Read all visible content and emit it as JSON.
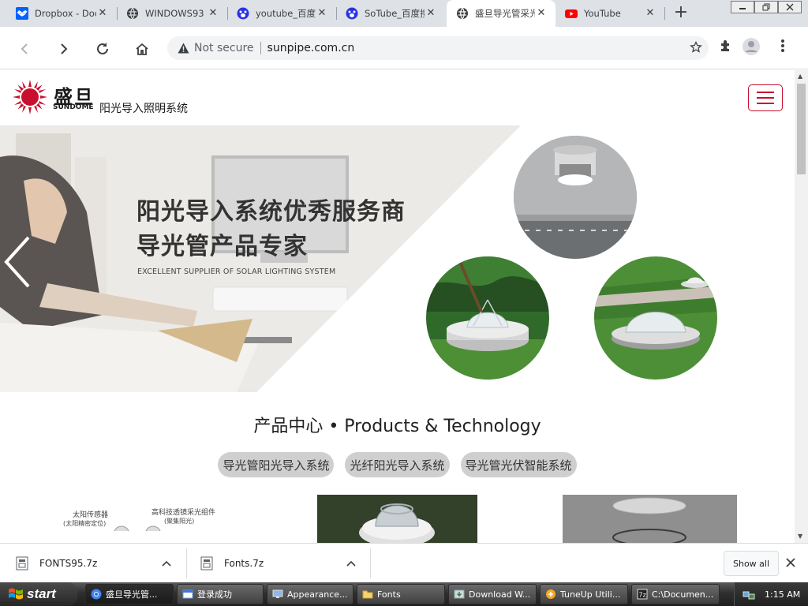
{
  "browser": {
    "tabs": [
      {
        "label": "Dropbox - Docu",
        "icon": "dropbox-icon",
        "active": false
      },
      {
        "label": "WINDOWS93",
        "icon": "globe-icon",
        "active": false
      },
      {
        "label": "youtube_百度搜",
        "icon": "baidu-icon",
        "active": false
      },
      {
        "label": "SoTube_百度搜",
        "icon": "baidu-icon",
        "active": false
      },
      {
        "label": "盛旦导光管采光",
        "icon": "globe-icon",
        "active": true
      },
      {
        "label": "YouTube",
        "icon": "youtube-icon",
        "active": false
      }
    ],
    "tab_close": "✕",
    "new_tab": "+",
    "address": {
      "security_label": "Not secure",
      "url": "sunpipe.com.cn"
    }
  },
  "site": {
    "logo": {
      "name_cn": "盛旦",
      "name_en": "SUNDOME",
      "tagline": "阳光导入照明系统"
    },
    "banner": {
      "title_line1": "阳光导入系统优秀服务商",
      "title_line2": "导光管产品专家",
      "subtitle": "EXCELLENT SUPPLIER OF SOLAR LIGHTING SYSTEM"
    },
    "products": {
      "heading": "产品中心 • Products & Technology",
      "categories": [
        "导光管阳光导入系统",
        "光纤阳光导入系统",
        "导光管光伏智能系统"
      ],
      "diagram_labels": {
        "sensor": "太阳传感器",
        "sensor_note": "(太阳精密定位)",
        "lens": "高科技透镜采光组件",
        "lens_note": "(聚集阳光)"
      }
    }
  },
  "downloads": {
    "items": [
      {
        "name": "FONTS95.7z"
      },
      {
        "name": "Fonts.7z"
      }
    ],
    "show_all": "Show all"
  },
  "taskbar": {
    "start": "start",
    "tasks": [
      {
        "label": "盛旦导光管...",
        "active": true
      },
      {
        "label": "登录成功",
        "active": false
      },
      {
        "label": "Appearance...",
        "active": false
      },
      {
        "label": "Fonts",
        "active": false
      },
      {
        "label": "Download W...",
        "active": false
      },
      {
        "label": "TuneUp Utili...",
        "active": false
      },
      {
        "label": "C:\\Documen...",
        "active": false
      }
    ],
    "clock": "1:15 AM"
  },
  "colors": {
    "brand_red": "#c8102e",
    "tab_strip": "#dee1e6",
    "pill_bg": "#cfcfcf"
  }
}
